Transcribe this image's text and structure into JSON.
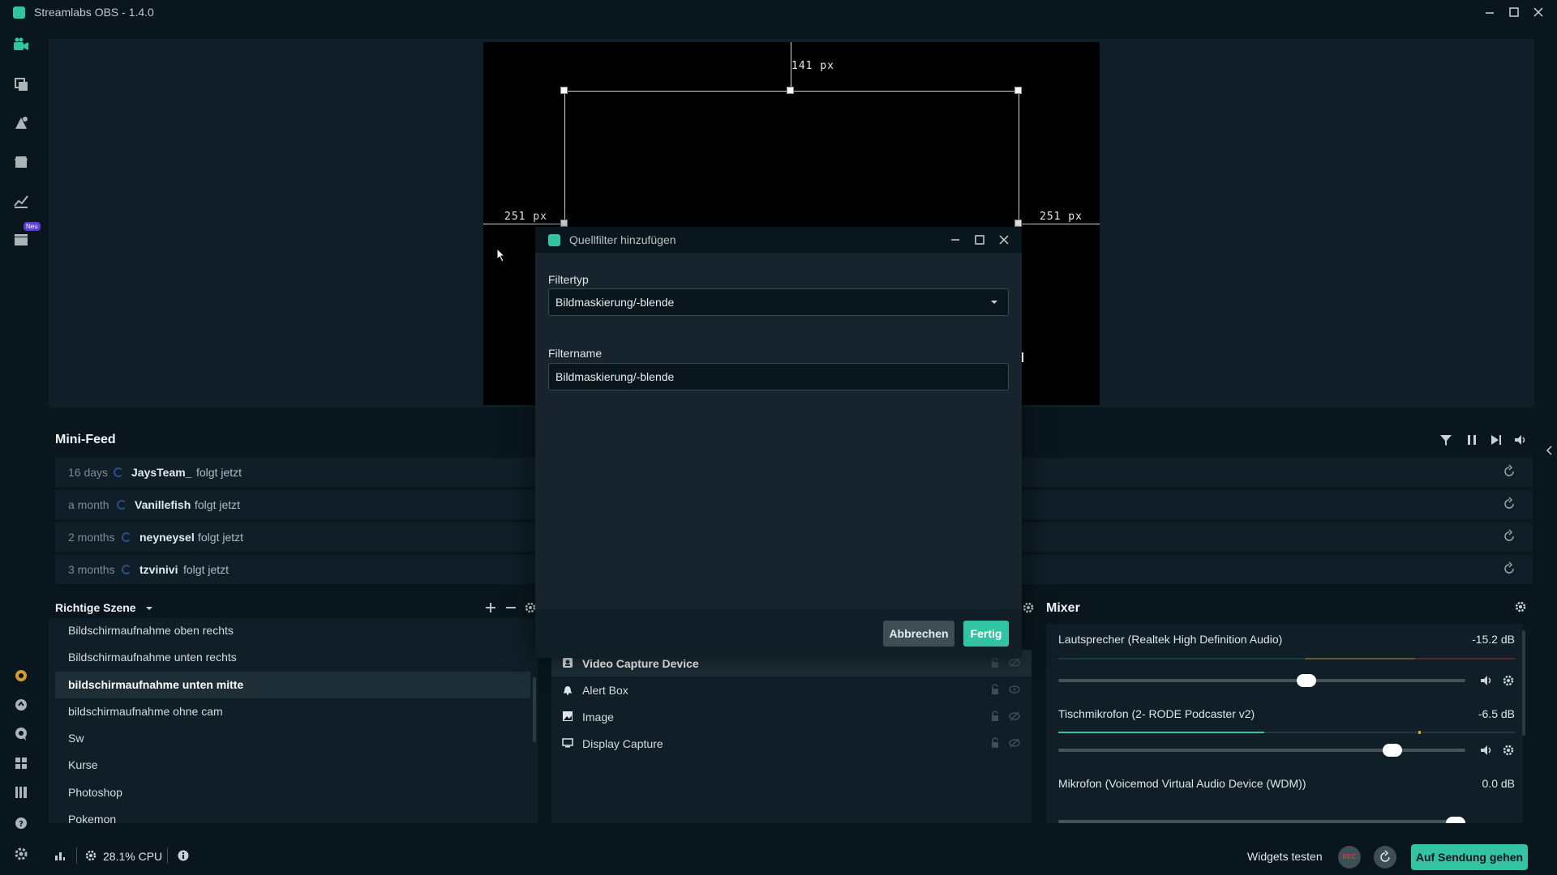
{
  "window": {
    "title": "Streamlabs OBS - 1.4.0"
  },
  "sidenav": {
    "badge": "Neu"
  },
  "editor": {
    "top_px": "141 px",
    "left_px": "251 px",
    "right_px": "251 px"
  },
  "dialog": {
    "title": "Quellfilter hinzufügen",
    "filter_type_label": "Filtertyp",
    "filter_type_value": "Bildmaskierung/-blende",
    "filter_name_label": "Filtername",
    "filter_name_value": "Bildmaskierung/-blende",
    "cancel_label": "Abbrechen",
    "done_label": "Fertig"
  },
  "minifeed": {
    "title": "Mini-Feed",
    "items": [
      {
        "time": "16 days",
        "name": "JaysTeam_",
        "action": "folgt jetzt"
      },
      {
        "time": "a month",
        "name": "Vanillefish",
        "action": "folgt jetzt"
      },
      {
        "time": "2 months",
        "name": "neyneysel",
        "action": "folgt jetzt"
      },
      {
        "time": "3 months",
        "name": "tzvinivi",
        "action": "folgt jetzt"
      }
    ]
  },
  "scenes": {
    "title": "Richtige Szene",
    "items": [
      "Bildschirmaufnahme oben rechts",
      "Bildschirmaufnahme unten rechts",
      "bildschirmaufnahme unten mitte",
      "bildschirmaufnahme ohne cam",
      "Sw",
      "Kurse",
      "Photoshop",
      "Pokemon"
    ],
    "active_index": 2
  },
  "sources": {
    "items": [
      {
        "label": "Video Capture Device",
        "icon": "camera-icon"
      },
      {
        "label": "Alert Box",
        "icon": "bell-icon"
      },
      {
        "label": "Image",
        "icon": "image-icon"
      },
      {
        "label": "Display Capture",
        "icon": "monitor-icon"
      }
    ],
    "active_index": 0
  },
  "mixer": {
    "title": "Mixer",
    "channels": [
      {
        "name": "Lautsprecher (Realtek High Definition Audio)",
        "db": "-15.2 dB",
        "level": 0.61
      },
      {
        "name": "Tischmikrofon (2- RODE Podcaster v2)",
        "db": "-6.5 dB",
        "level": 0.82
      },
      {
        "name": "Mikrofon (Voicemod Virtual Audio Device (WDM))",
        "db": "0.0 dB",
        "level": 1.0
      }
    ]
  },
  "footer": {
    "cpu": "28.1% CPU",
    "test_widgets": "Widgets testen",
    "rec": "REC",
    "go_live": "Auf Sendung gehen"
  },
  "colors": {
    "accent": "#31c3a2",
    "bg": "#09161d",
    "panel": "#0f1e27"
  }
}
